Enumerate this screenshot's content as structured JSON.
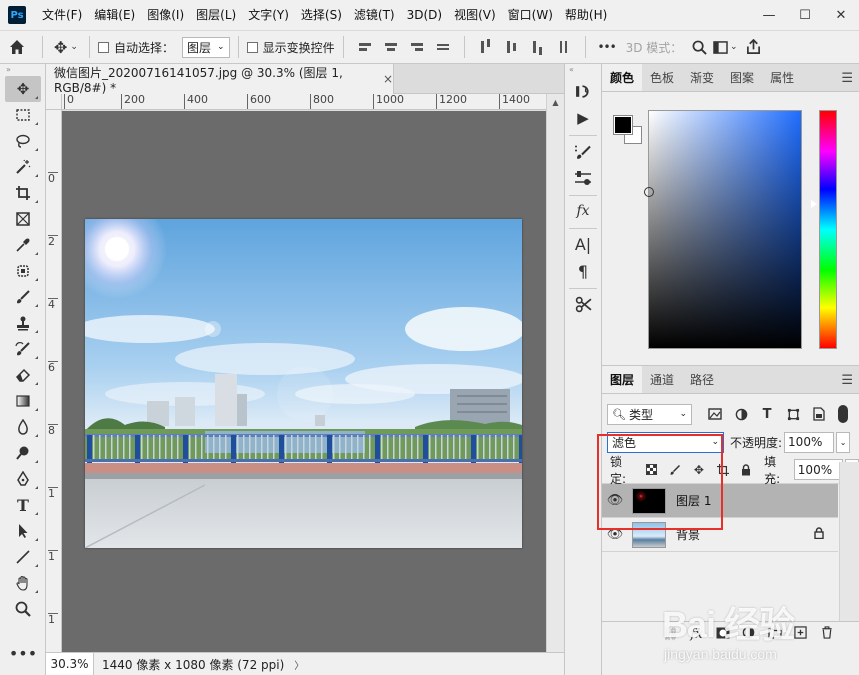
{
  "app": {
    "logo": "Ps"
  },
  "menu": [
    "文件(F)",
    "编辑(E)",
    "图像(I)",
    "图层(L)",
    "文字(Y)",
    "选择(S)",
    "滤镜(T)",
    "3D(D)",
    "视图(V)",
    "窗口(W)",
    "帮助(H)"
  ],
  "window_controls": {
    "minimize": "—",
    "maximize": "☐",
    "close": "✕"
  },
  "options_bar": {
    "auto_select_label": "自动选择：",
    "auto_select_value": "图层",
    "show_transform_label": "显示变换控件",
    "more": "•••",
    "mode_3d_label": "3D 模式："
  },
  "document": {
    "tab_title": "微信图片_20200716141057.jpg @ 30.3% (图层 1, RGB/8#) *",
    "close": "×",
    "ruler_h": [
      "0",
      "200",
      "400",
      "600",
      "800",
      "1000",
      "1200",
      "1400"
    ],
    "ruler_v": [
      "0",
      "2",
      "4",
      "6",
      "8",
      "1",
      "1",
      "1"
    ],
    "zoom": "30.3%",
    "info": "1440 像素 x 1080 像素 (72 ppi)",
    "status_arrow": "〉"
  },
  "color_panel": {
    "tabs": [
      "颜色",
      "色板",
      "渐变",
      "图案",
      "属性"
    ],
    "active_tab": "颜色",
    "foreground": "#000000",
    "background": "#ffffff"
  },
  "layers_panel": {
    "tabs": [
      "图层",
      "通道",
      "路径"
    ],
    "active_tab": "图层",
    "filter_label": "类型",
    "blend_mode": "滤色",
    "opacity_label": "不透明度:",
    "opacity_value": "100%",
    "lock_label": "锁定:",
    "fill_label": "填充:",
    "fill_value": "100%",
    "layers": [
      {
        "name": "图层 1",
        "selected": true,
        "locked": false
      },
      {
        "name": "背景",
        "selected": false,
        "locked": true
      }
    ]
  },
  "watermark": {
    "brand": "Bai 经验",
    "url": "jingyan.baidu.com"
  },
  "colors": {
    "highlight_box": "#e8302a",
    "canvas_bg": "#6b6b6b",
    "ui_bg": "#efefef"
  }
}
